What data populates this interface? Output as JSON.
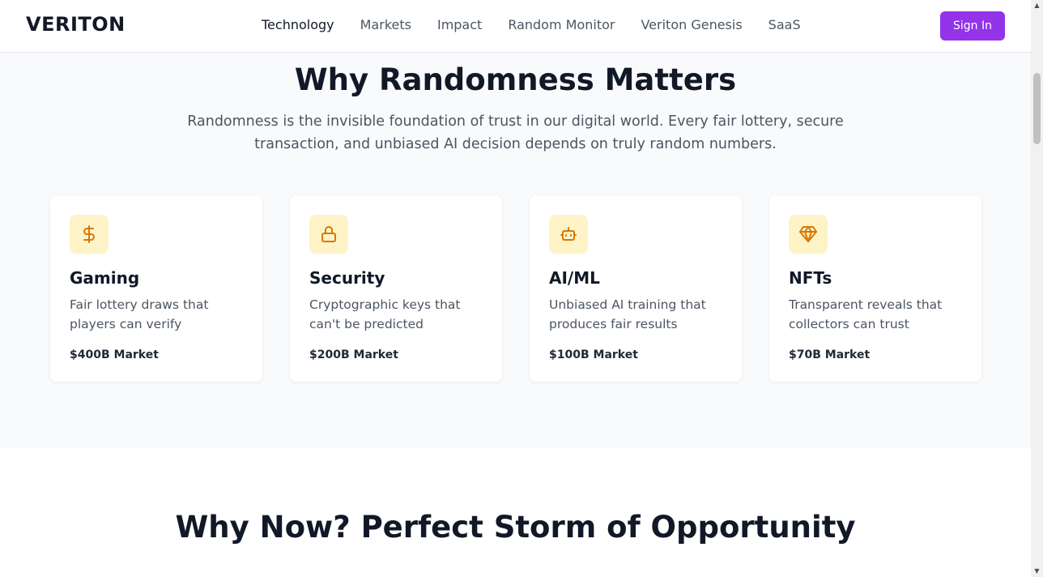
{
  "header": {
    "logo": "VERITON",
    "nav": [
      "Technology",
      "Markets",
      "Impact",
      "Random Monitor",
      "Veriton Genesis",
      "SaaS"
    ],
    "sign_in": "Sign In"
  },
  "why_randomness": {
    "title": "Why Randomness Matters",
    "subtitle_line1": "Randomness is the invisible foundation of trust in our digital world. Every fair lottery, secure",
    "subtitle_line2": "transaction, and unbiased AI decision depends on truly random numbers.",
    "cards": [
      {
        "icon": "dollar-icon",
        "title": "Gaming",
        "desc_line1": "Fair lottery draws that",
        "desc_line2": "players can verify",
        "market": "$400B Market"
      },
      {
        "icon": "lock-icon",
        "title": "Security",
        "desc_line1": "Cryptographic keys that",
        "desc_line2": "can't be predicted",
        "market": "$200B Market"
      },
      {
        "icon": "robot-icon",
        "title": "AI/ML",
        "desc_line1": "Unbiased AI training that",
        "desc_line2": "produces fair results",
        "market": "$100B Market"
      },
      {
        "icon": "diamond-icon",
        "title": "NFTs",
        "desc_line1": "Transparent reveals that",
        "desc_line2": "collectors can trust",
        "market": "$70B Market"
      }
    ]
  },
  "why_now": {
    "title": "Why Now? Perfect Storm of Opportunity"
  },
  "colors": {
    "accent": "#9333ea",
    "icon_bg": "#fef3c7",
    "icon_fg": "#d97706",
    "section_bg": "#f9fafb"
  }
}
